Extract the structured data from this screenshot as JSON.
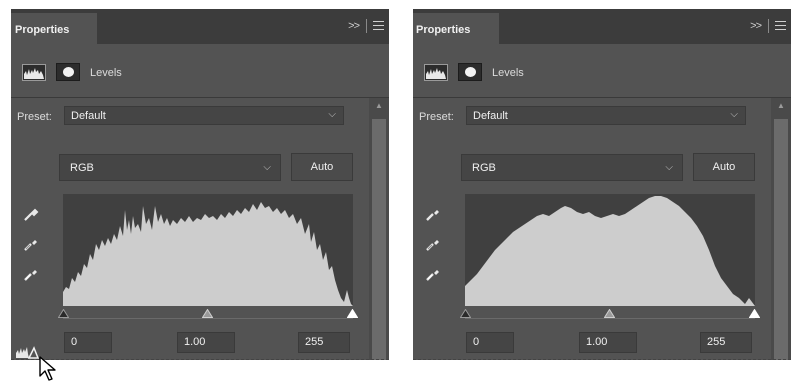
{
  "panels": [
    {
      "title": "Properties",
      "adjustment": "Levels",
      "preset_label": "Preset:",
      "preset_value": "Default",
      "channel": "RGB",
      "auto_label": "Auto",
      "input_black": "0",
      "input_gamma": "1.00",
      "input_white": "255",
      "histogram": "uneven-spiky"
    },
    {
      "title": "Properties",
      "adjustment": "Levels",
      "preset_label": "Preset:",
      "preset_value": "Default",
      "channel": "RGB",
      "auto_label": "Auto",
      "input_black": "0",
      "input_gamma": "1.00",
      "input_white": "255",
      "histogram": "smooth"
    }
  ],
  "icons": {
    "collapse": "double-chevron-right-icon",
    "menu": "panel-menu-icon",
    "levels": "levels-icon",
    "mask": "mask-icon",
    "dropdown": "chevron-down-icon",
    "eyedroppers": [
      "black-point-eyedropper-icon",
      "gray-point-eyedropper-icon",
      "white-point-eyedropper-icon"
    ],
    "cursor": "mouse-pointer-icon"
  },
  "colors": {
    "panel_bg": "#535353",
    "titlebar_bg": "#3c3c3c",
    "histogram_bg": "#404040",
    "histogram_fill": "#cdcdcd",
    "field_bg": "#454545"
  }
}
